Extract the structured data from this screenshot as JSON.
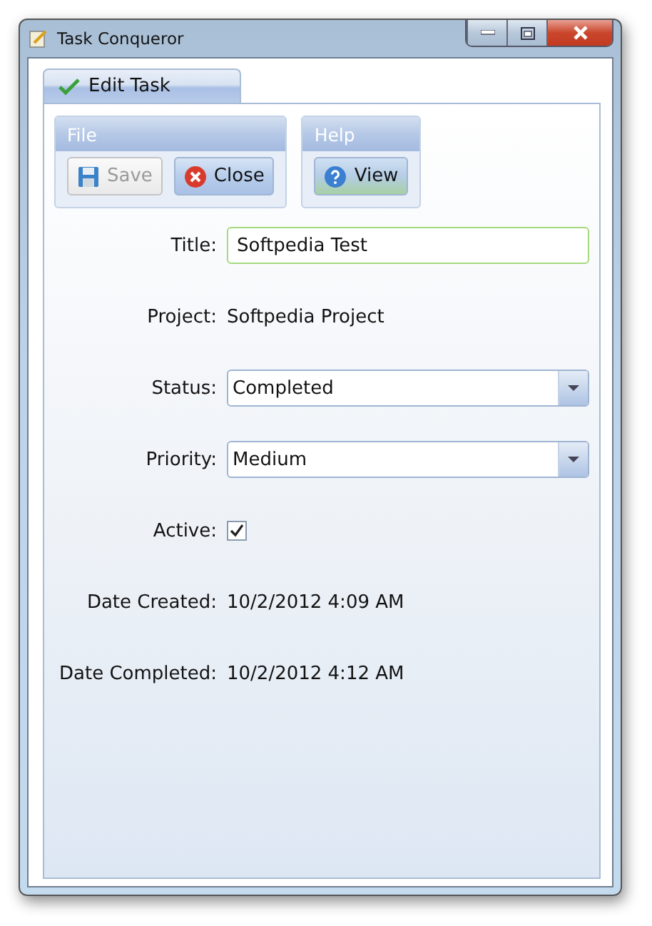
{
  "window": {
    "title": "Task Conqueror"
  },
  "tabs": [
    {
      "label": "Edit Task",
      "selected": true
    }
  ],
  "groups": [
    {
      "title": "File",
      "buttons": [
        {
          "label": "Save",
          "kind": "save",
          "disabled": true
        },
        {
          "label": "Close",
          "kind": "close",
          "disabled": false
        }
      ]
    },
    {
      "title": "Help",
      "buttons": [
        {
          "label": "View",
          "kind": "help",
          "disabled": false
        }
      ]
    }
  ],
  "fields": [
    {
      "kind": "textbox",
      "label": "Title:",
      "value": "Softpedia Test"
    },
    {
      "kind": "text",
      "label": "Project:",
      "value": "Softpedia Project"
    },
    {
      "kind": "dropdown",
      "label": "Status:",
      "value": "Completed"
    },
    {
      "kind": "dropdown",
      "label": "Priority:",
      "value": "Medium"
    },
    {
      "kind": "checkbox",
      "label": "Active:",
      "checked": true
    },
    {
      "kind": "text",
      "label": "Date Created:",
      "value": "10/2/2012 4:09 AM"
    },
    {
      "kind": "text",
      "label": "Date Completed:",
      "value": "10/2/2012 4:12 AM"
    }
  ]
}
